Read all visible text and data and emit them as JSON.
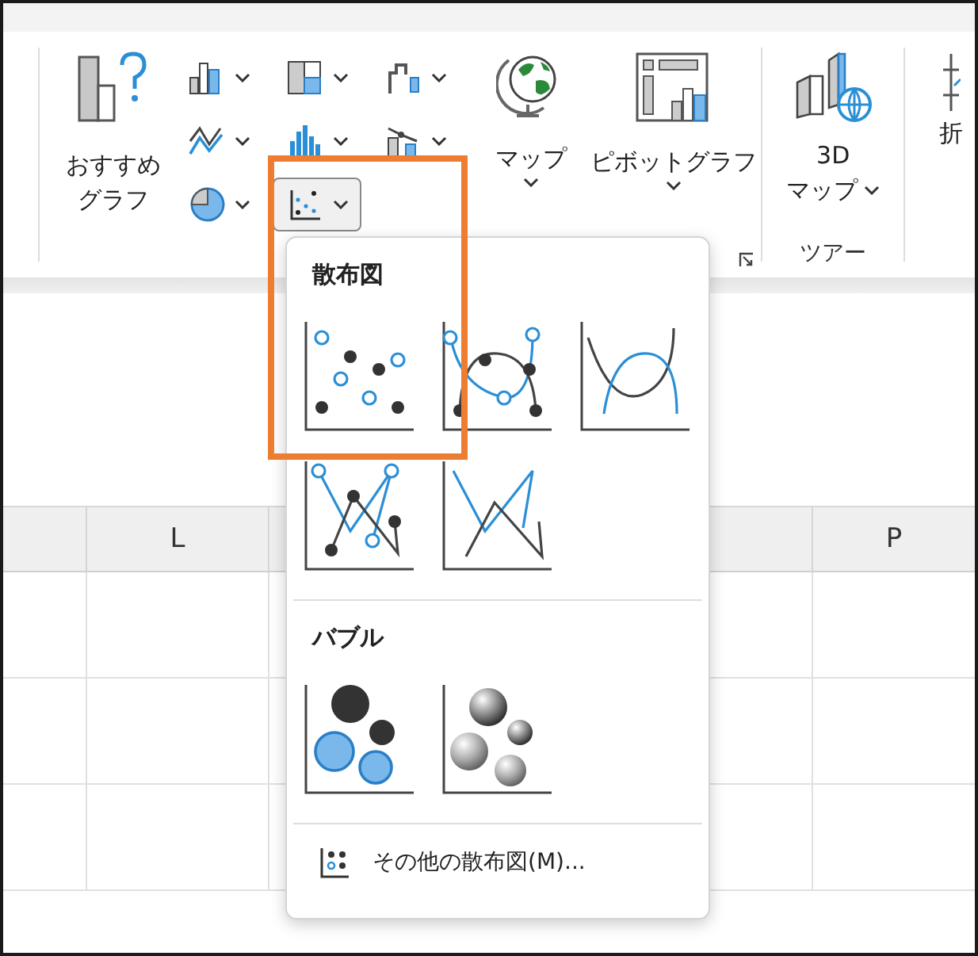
{
  "ribbon": {
    "recommended_button": {
      "label_lines": [
        "おすすめ",
        "グラフ"
      ]
    },
    "chart_buttons": [
      {
        "kind": "column",
        "selected": false
      },
      {
        "kind": "hierarchy",
        "selected": false
      },
      {
        "kind": "waterfall",
        "selected": false
      },
      {
        "kind": "line",
        "selected": false
      },
      {
        "kind": "statistic",
        "selected": false
      },
      {
        "kind": "combo",
        "selected": false
      },
      {
        "kind": "pie",
        "selected": false
      },
      {
        "kind": "scatter",
        "selected": true
      }
    ],
    "map_button": {
      "label": "マップ"
    },
    "pivot_button": {
      "label": "ピボットグラフ"
    },
    "map3d_button": {
      "label_lines": [
        "3D",
        "マップ"
      ]
    },
    "group_label": "ツアー",
    "cut_button": {
      "label": "折"
    }
  },
  "sheet": {
    "columns": [
      {
        "label": "L"
      },
      {
        "label": "P"
      }
    ]
  },
  "dropdown": {
    "sections": [
      {
        "title": "散布図",
        "items": [
          {
            "kind": "scatter"
          },
          {
            "kind": "smooth-markers"
          },
          {
            "kind": "smooth"
          },
          {
            "kind": "straight-markers"
          },
          {
            "kind": "straight"
          }
        ]
      },
      {
        "title": "バブル",
        "items": [
          {
            "kind": "bubble"
          },
          {
            "kind": "bubble-3d"
          }
        ]
      }
    ],
    "footer": "その他の散布図(M)..."
  }
}
